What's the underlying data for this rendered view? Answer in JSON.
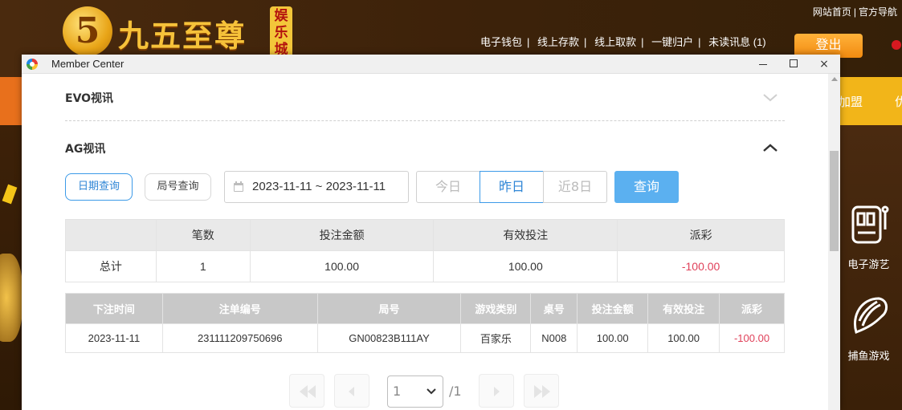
{
  "site": {
    "logo_numeral": "5",
    "logo_text": "九五至尊",
    "logo_badge": [
      "娱",
      "乐",
      "城"
    ],
    "top_links": [
      "网站首页",
      "官方导航"
    ],
    "nav_links": [
      "电子钱包",
      "线上存款",
      "线上取款",
      "一键归户",
      "未读讯息 (1)"
    ],
    "logout_label": "登出",
    "nav_partial_1": "加盟",
    "nav_partial_2": "优",
    "side_items": [
      "电子游艺",
      "捕鱼游戏"
    ]
  },
  "window": {
    "title": "Member Center",
    "controls": {
      "minimize": "minimize",
      "maximize": "maximize",
      "close": "×"
    }
  },
  "sections": {
    "evo": {
      "title": "EVO视讯"
    },
    "ag": {
      "title": "AG视讯"
    }
  },
  "filters": {
    "date_query_label": "日期查询",
    "round_query_label": "局号查询",
    "date_range": "2023-11-11 ~ 2023-11-11",
    "today_label": "今日",
    "yesterday_label": "昨日",
    "last8_label": "近8日",
    "query_label": "查询"
  },
  "summary": {
    "headers": [
      "",
      "笔数",
      "投注金额",
      "有效投注",
      "派彩"
    ],
    "row": [
      "总计",
      "1",
      "100.00",
      "100.00",
      "-100.00"
    ]
  },
  "details": {
    "headers": [
      "下注时间",
      "注单编号",
      "局号",
      "游戏类别",
      "桌号",
      "投注金额",
      "有效投注",
      "派彩"
    ],
    "rows": [
      [
        "2023-11-11",
        "231111209750696",
        "GN00823B111AY",
        "百家乐",
        "N008",
        "100.00",
        "100.00",
        "-100.00"
      ]
    ]
  },
  "pager": {
    "current_page": "1",
    "total_pages": "/1"
  },
  "colors": {
    "accent_blue": "#3c9ae8",
    "query_button": "#5bb0f0",
    "negative": "#e0415a"
  }
}
